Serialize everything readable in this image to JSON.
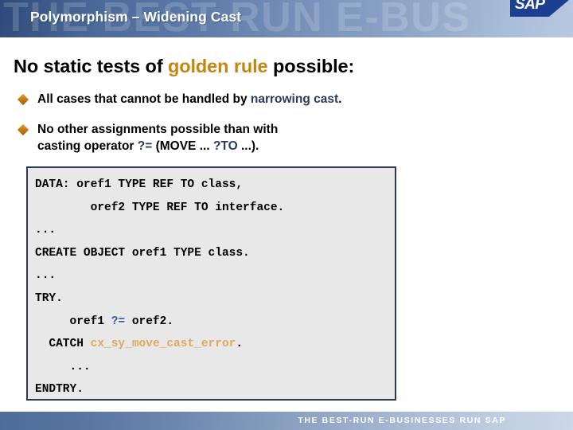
{
  "header": {
    "title": "Polymorphism – Widening Cast",
    "watermark": "THE BEST RUN E-BUS"
  },
  "slide": {
    "heading": {
      "part1": "No static tests of ",
      "highlight": "golden rule",
      "part2": " possible:"
    },
    "bullets": [
      {
        "marker": "diamond",
        "part1": "All cases that cannot be handled by ",
        "highlight": "narrowing cast",
        "part2": "."
      },
      {
        "marker": "diamond",
        "part1": "No other assignments possible than with\ncasting operator ",
        "highlight": "?=",
        "part2": " (MOVE ... ",
        "highlight2": "?TO",
        "part3": " ...)."
      }
    ],
    "code": {
      "line1": "DATA: oref1 TYPE REF TO class,",
      "line2": "        oref2 TYPE REF TO interface.",
      "line3": "...",
      "line4": "CREATE OBJECT oref1 TYPE class.",
      "line5": "...",
      "line6": "TRY.",
      "line7_pre": "     oref1 ",
      "line7_op": "?=",
      "line7_post": " oref2.",
      "line8_pre": "  CATCH ",
      "line8_exc": "cx_sy_move_cast_error",
      "line8_post": ".",
      "line9": "     ...",
      "line10": "ENDTRY."
    }
  },
  "footer": {
    "tagline": "THE BEST-RUN E-BUSINESSES RUN SAP",
    "logo_text": "SAP",
    "logo_tm": "™"
  },
  "colors": {
    "gold": "#c4860f",
    "navy": "#2b3a5e",
    "code_blue": "#3a5c9e",
    "code_gold": "#e0a860",
    "header_dark": "#2d4a7a",
    "sap_blue": "#1c3f8f"
  }
}
